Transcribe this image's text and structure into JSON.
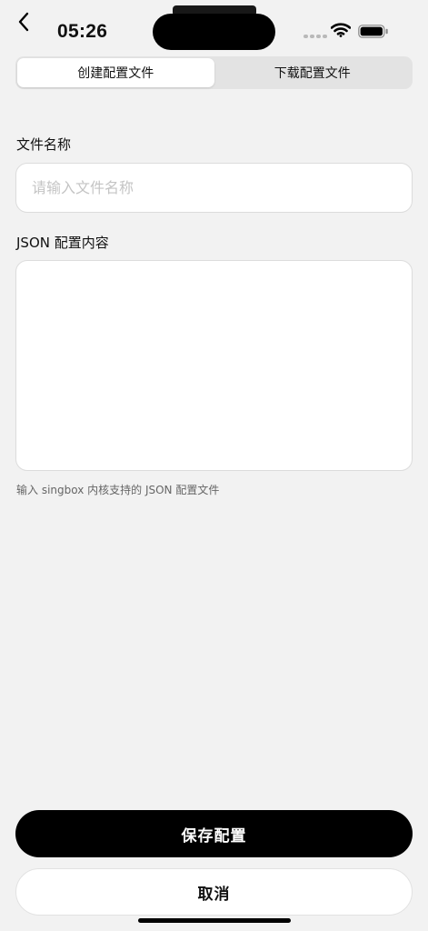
{
  "status_bar": {
    "time": "05:26"
  },
  "tabs": [
    {
      "label": "创建配置文件",
      "active": true
    },
    {
      "label": "下载配置文件",
      "active": false
    }
  ],
  "form": {
    "filename_label": "文件名称",
    "filename_placeholder": "请输入文件名称",
    "filename_value": "",
    "json_label": "JSON 配置内容",
    "json_value": "",
    "json_hint": "输入 singbox 内核支持的 JSON 配置文件"
  },
  "actions": {
    "save_label": "保存配置",
    "cancel_label": "取消"
  },
  "colors": {
    "background": "#f2f2f2",
    "primary": "#000000",
    "surface": "#ffffff"
  }
}
